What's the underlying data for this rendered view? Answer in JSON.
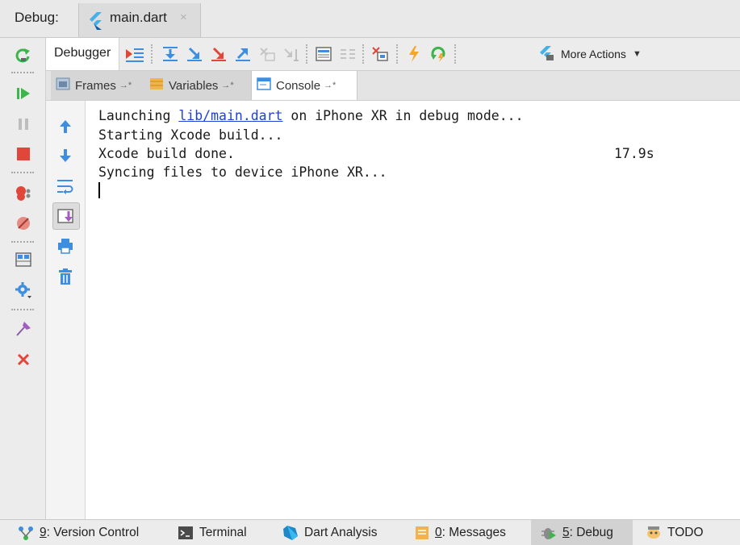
{
  "window": {
    "debug_label": "Debug:",
    "file_tab": {
      "name": "main.dart",
      "close_glyph": "×"
    }
  },
  "colors": {
    "flutter_blue": "#45b1e8",
    "run_green": "#3cb54a",
    "stop_red": "#e0473a",
    "step_blue": "#3d8ee0",
    "step_red": "#e0473a",
    "link_blue": "#2140d6",
    "active_tab_bg": "#d2d2d2"
  },
  "left_toolbar": {
    "items": [
      {
        "icon": "rerun-icon"
      },
      {
        "icon": "resume-icon"
      },
      {
        "icon": "pause-icon"
      },
      {
        "icon": "stop-icon"
      },
      {
        "icon": "view-breakpoints-icon"
      },
      {
        "icon": "mute-breakpoints-icon"
      },
      {
        "icon": "restore-layout-icon"
      },
      {
        "icon": "settings-icon"
      },
      {
        "icon": "pin-icon"
      },
      {
        "icon": "close-icon"
      }
    ]
  },
  "debugger_toolbar": {
    "tab_label": "Debugger",
    "icons": [
      "show-execution-point-icon",
      "step-over-icon",
      "step-into-icon",
      "force-step-into-icon",
      "step-out-icon",
      "drop-frame-icon",
      "run-to-cursor-icon",
      "evaluate-expression-icon",
      "trace-icon",
      "open-devtools-icon",
      "hot-reload-icon",
      "hot-restart-icon",
      "flutter-actions-icon"
    ],
    "more_actions_label": "More Actions"
  },
  "sub_tabs": [
    {
      "label": "Frames",
      "arrow": "→*",
      "icon": "frames-icon"
    },
    {
      "label": "Variables",
      "arrow": "→*",
      "icon": "variables-icon"
    },
    {
      "label": "Console",
      "arrow": "→*",
      "icon": "console-icon",
      "active": true
    }
  ],
  "console_toolbar": {
    "icons": [
      "up-stack-icon",
      "down-stack-icon",
      "soft-wrap-icon",
      "scroll-to-end-icon",
      "print-icon",
      "clear-all-icon"
    ],
    "active_icon": "scroll-to-end-icon"
  },
  "console": {
    "line1_prefix": "Launching ",
    "line1_link": "lib/main.dart",
    "line1_suffix": " on iPhone XR in debug mode...",
    "line2": "Starting Xcode build...",
    "line3": "Xcode build done.",
    "line3_time": "17.9s",
    "line4": "Syncing files to device iPhone XR..."
  },
  "bottom_bar": {
    "items": [
      {
        "num": "9",
        "label": ": Version Control",
        "icon": "version-control-icon"
      },
      {
        "num": "",
        "label": "Terminal",
        "icon": "terminal-icon"
      },
      {
        "num": "",
        "label": "Dart Analysis",
        "icon": "dart-analysis-icon"
      },
      {
        "num": "0",
        "label": ": Messages",
        "icon": "messages-icon"
      },
      {
        "num": "5",
        "label": ": Debug",
        "icon": "debug-icon",
        "active": true
      },
      {
        "num": "",
        "label": "TODO",
        "icon": "todo-icon"
      }
    ]
  }
}
